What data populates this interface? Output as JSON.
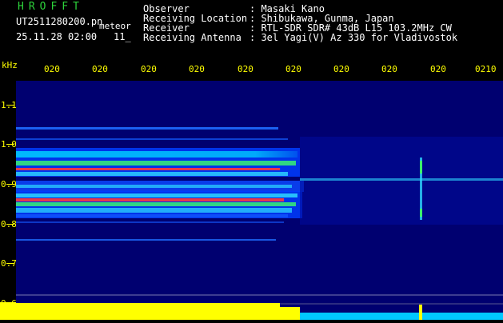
{
  "header": {
    "title": "HROFFT",
    "filename": "UT2511280200.pn",
    "mode": "meteor",
    "datetime": "25.11.28 02:00",
    "counter": "11_",
    "observer_label": "Observer",
    "observer_value": ": Masaki Kano",
    "location_label": "Receiving Location",
    "location_value": ": Shibukawa, Gunma, Japan",
    "receiver_label": "Receiver",
    "receiver_value": ": RTL-SDR SDR# 43dB L15 103.2MHz CW",
    "antenna_label": "Receiving Antenna",
    "antenna_value": ": 3el Yagi(V) Az 330 for Vladivostok"
  },
  "time_axis": {
    "labels": [
      "020",
      "020",
      "020",
      "020",
      "020",
      "020",
      "020",
      "020",
      "020",
      "0210"
    ]
  },
  "freq_axis": {
    "unit": "kHz",
    "labels": [
      "1.1",
      "1.0",
      "0.9",
      "0.8",
      "0.7",
      "0.6"
    ]
  },
  "colors": {
    "text": "#ffffff",
    "title": "#2dd33b",
    "axis": "#ffff00",
    "background": "#000070"
  }
}
